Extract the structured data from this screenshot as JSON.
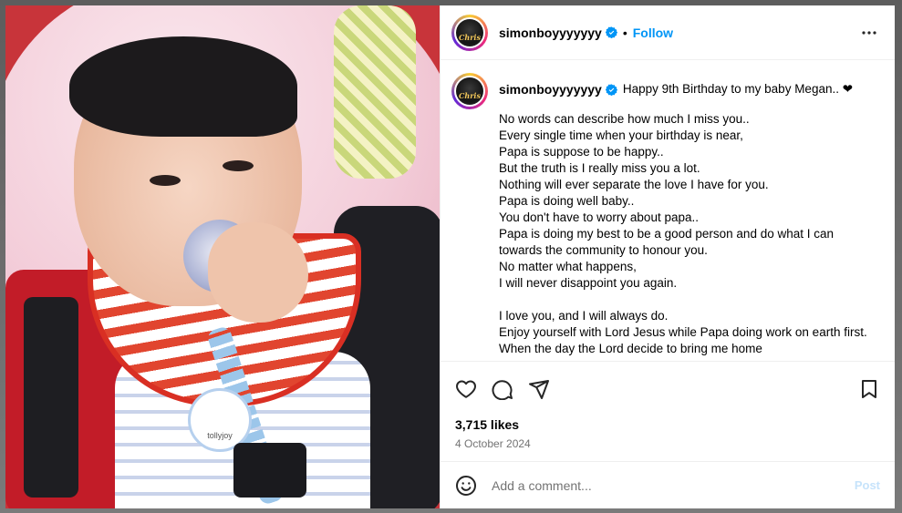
{
  "header": {
    "username": "simonboyyyyyyy",
    "avatar_text": "Chris",
    "separator": "•",
    "follow_label": "Follow"
  },
  "caption": {
    "username": "simonboyyyyyyy",
    "first_line": "Happy 9th Birthday to my baby Megan.. ❤",
    "lines": [
      "No words can describe how much I miss you..",
      "Every single time when your birthday is near,",
      "Papa is suppose to be happy..",
      "But the truth is I really miss you a lot.",
      "Nothing will ever separate the love I have for you.",
      "Papa is doing well baby..",
      "You don't have to worry about papa..",
      "Papa is doing my best to be a good person and do what I can towards the community to honour you.",
      "No matter what happens,",
      "I will never disappoint you again.",
      "",
      "I love you, and I will always do.",
      "Enjoy yourself with Lord Jesus while Papa doing work on earth first.",
      "When the day the Lord decide to bring me home"
    ]
  },
  "stats": {
    "likes": "3,715 likes",
    "date": "4 October 2024"
  },
  "comment": {
    "placeholder": "Add a comment...",
    "post_label": "Post"
  },
  "photo": {
    "clip_text": "tollyjoy"
  },
  "colors": {
    "accent": "#0095f6",
    "verified": "#0095f6",
    "muted": "#737373"
  }
}
